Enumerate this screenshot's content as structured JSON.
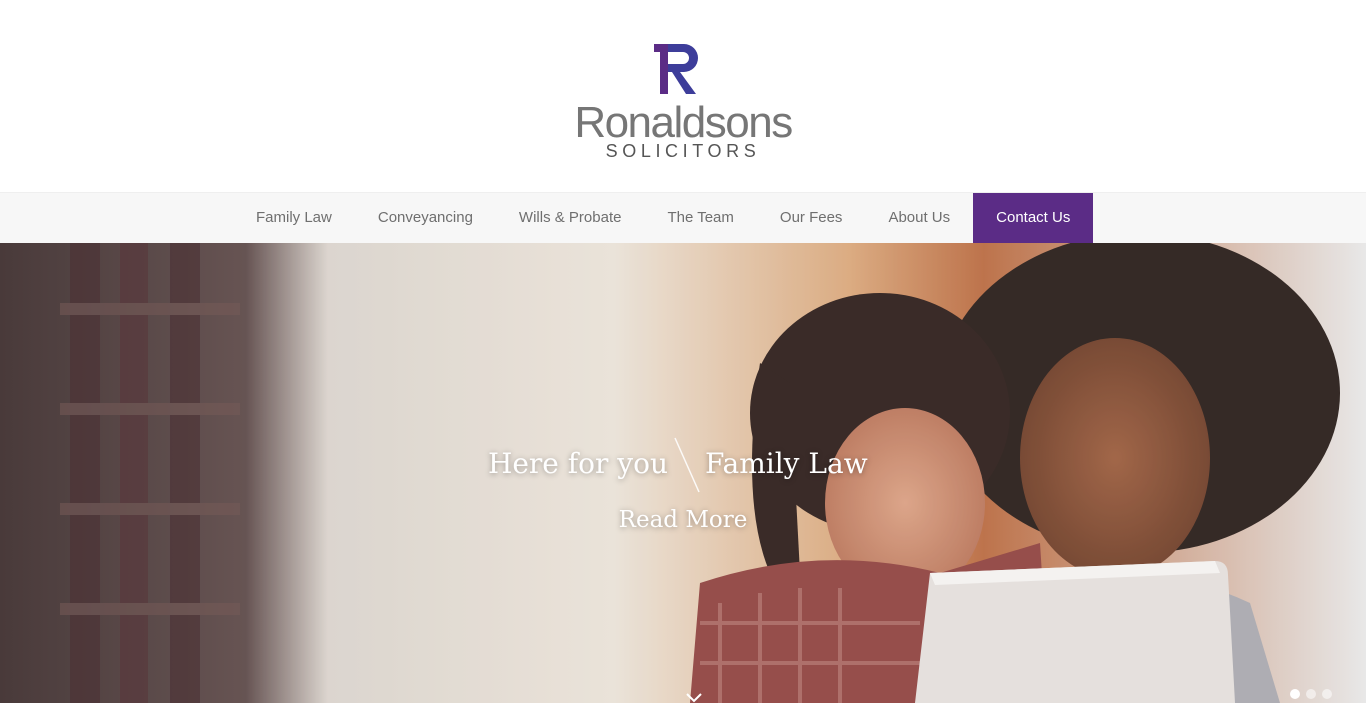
{
  "brand": {
    "name": "Ronaldsons",
    "sub": "SOLICITORS",
    "mark_colors": [
      "#3d3d9a",
      "#5b2c86"
    ]
  },
  "nav": {
    "items": [
      {
        "label": "Family Law"
      },
      {
        "label": "Conveyancing"
      },
      {
        "label": "Wills & Probate"
      },
      {
        "label": "The Team"
      },
      {
        "label": "Our Fees"
      },
      {
        "label": "About Us"
      },
      {
        "label": "Contact Us"
      }
    ],
    "cta_color": "#5b2c86"
  },
  "hero": {
    "title_left": "Here for you",
    "title_right": "Family Law",
    "cta": "Read More",
    "slides": 3,
    "active_slide": 1,
    "image": "mother-and-daughter-using-tablet"
  }
}
